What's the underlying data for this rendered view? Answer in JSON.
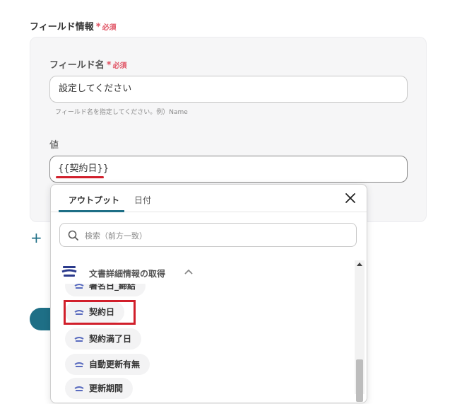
{
  "section": {
    "title": "フィールド情報",
    "required": "必須"
  },
  "field_name": {
    "label": "フィールド名",
    "required": "必須",
    "value": "設定してください",
    "hint": "フィールド名を指定してください。例）Name"
  },
  "value_field": {
    "label": "値",
    "value": "{{契約日}}"
  },
  "add_icon": "+",
  "dropdown": {
    "tabs": [
      "アウトプット",
      "日付"
    ],
    "search_placeholder": "検索（前方一致）",
    "group_title": "文書詳細情報の取得",
    "items": [
      "署名日_締結",
      "契約日",
      "契約満了日",
      "自動更新有無",
      "更新期間"
    ]
  },
  "colors": {
    "accent": "#1e6f86",
    "required": "#e05263",
    "highlight": "#d11f2b"
  },
  "icons": [
    "plus-icon",
    "close-icon",
    "search-icon",
    "gmo-sign-logo",
    "chevron-up-icon"
  ]
}
